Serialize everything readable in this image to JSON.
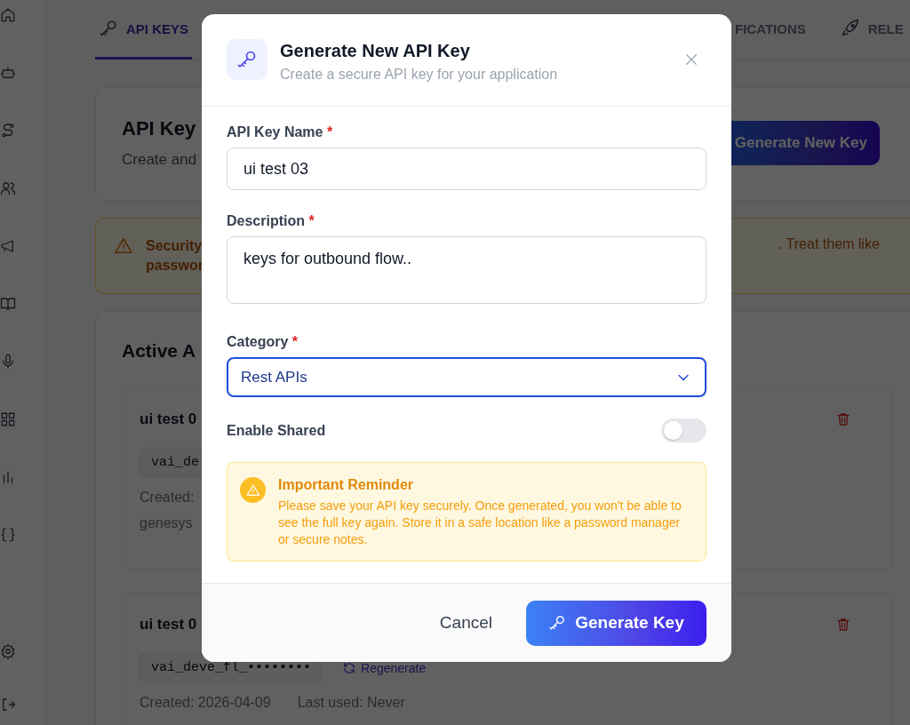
{
  "tabs": [
    {
      "label": "API KEYS",
      "selected": true
    },
    {
      "label": "FICATIONS",
      "selected": false
    },
    {
      "label": "RELE",
      "selected": false
    }
  ],
  "header": {
    "title": "API Key",
    "subtitle": "Create and",
    "button": "Generate New Key"
  },
  "security_notice": {
    "lines": [
      "Security",
      "passwor"
    ],
    "text_right": ". Treat them like"
  },
  "active_keys": {
    "title": "Active A",
    "keys": [
      {
        "name": "ui test 0",
        "key": "vai_de",
        "lines": [
          "Created:",
          "genesys"
        ]
      },
      {
        "name": "ui test 0",
        "key": "vai_deve_fl_••••••••",
        "action": "Regenerate",
        "lines": [
          "Created: 2026-04-09",
          "Last used: Never"
        ]
      }
    ]
  },
  "dialog": {
    "title": "Generate New API Key",
    "subtitle": "Create a secure API key for your application",
    "fields": [
      {
        "kind": "text",
        "label": "API Key Name",
        "required_mark": "*",
        "value": "ui test 03"
      },
      {
        "kind": "textarea",
        "label": "Description",
        "required_mark": "*",
        "value": "keys for outbound flow.."
      },
      {
        "kind": "select",
        "label": "Category",
        "required_mark": "*",
        "value": "Rest APIs",
        "focused": true
      },
      {
        "kind": "toggle",
        "label": "Enable Shared",
        "on": false
      }
    ],
    "reminder": {
      "title": "Important Reminder",
      "text": "Please save your API key securely. Once generated, you won't be able to see the full key again. Store it in a safe location like a password manager or secure notes."
    },
    "buttons": [
      {
        "label": "Cancel",
        "kind": "secondary"
      },
      {
        "label": "Generate Key",
        "kind": "primary"
      }
    ]
  }
}
